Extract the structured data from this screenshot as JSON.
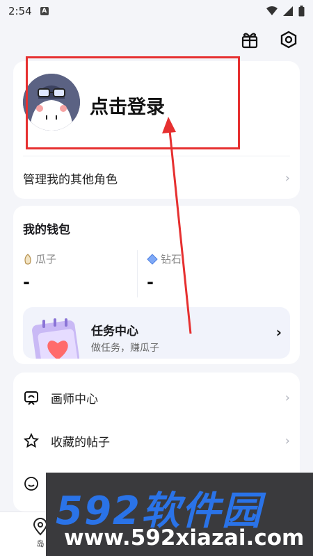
{
  "status_bar": {
    "time": "2:54",
    "notification_badge": "A"
  },
  "header": {
    "gift_icon": "gift-icon",
    "settings_icon": "settings-hex-icon"
  },
  "profile": {
    "login_label": "点击登录",
    "manage_roles_label": "管理我的其他角色",
    "chevron": "›"
  },
  "wallet": {
    "title": "我的钱包",
    "seeds_label": "瓜子",
    "seeds_value": "-",
    "diamonds_label": "钻石",
    "diamonds_value": "-",
    "task": {
      "title": "任务中心",
      "subtitle": "做任务，赚瓜子",
      "chevron": "›"
    }
  },
  "menu": {
    "items": [
      {
        "label": "画师中心",
        "icon": "painter-icon",
        "chevron": "›"
      },
      {
        "label": "收藏的帖子",
        "icon": "star-icon",
        "chevron": "›"
      },
      {
        "label": "",
        "icon": "smile-icon"
      }
    ]
  },
  "bottom_nav": {
    "island_label": "岛"
  },
  "watermark": {
    "brand": "592软件园",
    "url": "www.592xiazai.com"
  },
  "colors": {
    "annotation_red": "#e63030",
    "accent_blue": "#2a73e8"
  }
}
